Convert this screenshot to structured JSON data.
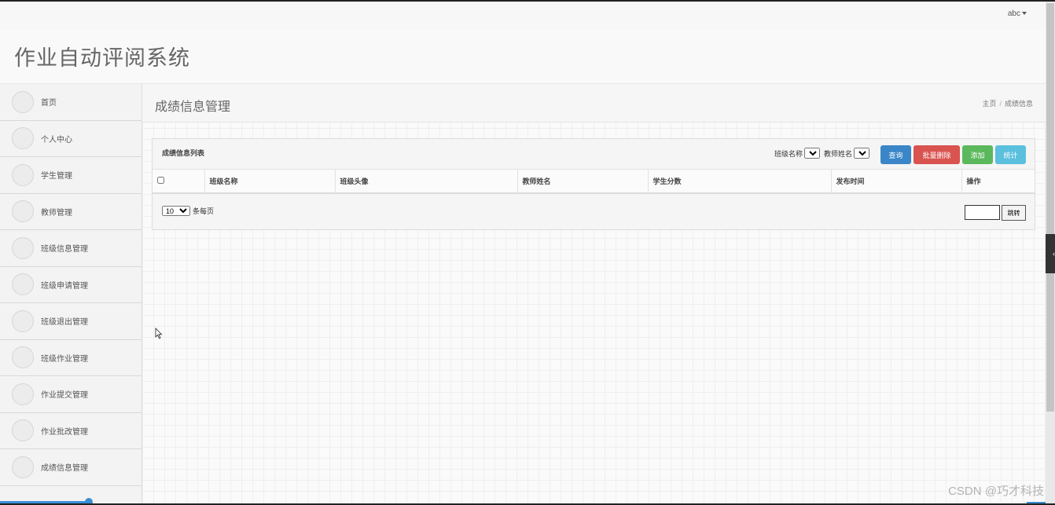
{
  "topbar": {
    "user_label": "abc"
  },
  "header": {
    "app_title": "作业自动评阅系统"
  },
  "sidebar": {
    "items": [
      {
        "label": "首页"
      },
      {
        "label": "个人中心"
      },
      {
        "label": "学生管理"
      },
      {
        "label": "教师管理"
      },
      {
        "label": "班级信息管理"
      },
      {
        "label": "班级申请管理"
      },
      {
        "label": "班级退出管理"
      },
      {
        "label": "班级作业管理"
      },
      {
        "label": "作业提交管理"
      },
      {
        "label": "作业批改管理"
      },
      {
        "label": "成绩信息管理"
      }
    ]
  },
  "main": {
    "page_title": "成绩信息管理",
    "breadcrumb": {
      "home": "主页",
      "separator": "/",
      "current": "成绩信息"
    },
    "panel": {
      "title": "成绩信息列表",
      "filters": {
        "class_name_label": "班级名称",
        "teacher_name_label": "教师姓名"
      },
      "buttons": {
        "query": "查询",
        "batch_delete": "批量删除",
        "add": "添加",
        "stats": "统计"
      },
      "table": {
        "columns": [
          "班级名称",
          "班级头像",
          "教师姓名",
          "学生分数",
          "发布时间",
          "操作"
        ]
      },
      "pager": {
        "page_size_value": "10",
        "page_size_suffix": "条每页",
        "jump_label": "跳转"
      }
    }
  },
  "watermark": "CSDN @巧才科技",
  "colors": {
    "query": "#3a86c8",
    "delete": "#d9534f",
    "add": "#5cb85c",
    "stats": "#5bc0de"
  }
}
